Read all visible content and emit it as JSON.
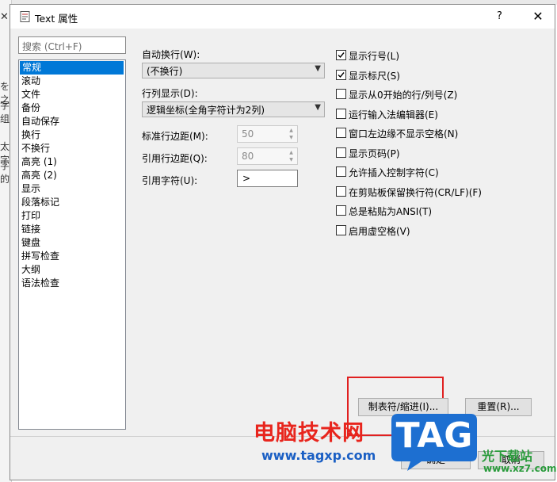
{
  "background": {
    "side_chars": [
      "を之",
      "字组",
      "太字",
      "字的"
    ]
  },
  "dialog": {
    "title": "Text 属性",
    "help": "?",
    "close": "✕"
  },
  "search": {
    "placeholder": "搜索 (Ctrl+F)"
  },
  "categories": [
    "常规",
    "滚动",
    "文件",
    "备份",
    "自动保存",
    "换行",
    "不换行",
    "高亮 (1)",
    "高亮 (2)",
    "显示",
    "段落标记",
    "打印",
    "链接",
    "键盘",
    "拼写检查",
    "大纲",
    "语法检查"
  ],
  "selected_category": "常规",
  "left_panel": {
    "wrap_label": "自动换行(W):",
    "wrap_value": "(不换行)",
    "col_label": "行列显示(D):",
    "col_value": "逻辑坐标(全角字符计为2列)",
    "std_margin_label": "标准行边距(M):",
    "std_margin_value": "50",
    "quote_margin_label": "引用行边距(Q):",
    "quote_margin_value": "80",
    "quote_char_label": "引用字符(U):",
    "quote_char_value": ">"
  },
  "checkboxes": [
    {
      "label": "显示行号(L)",
      "checked": true
    },
    {
      "label": "显示标尺(S)",
      "checked": true
    },
    {
      "label": "显示从0开始的行/列号(Z)",
      "checked": false
    },
    {
      "label": "运行输入法编辑器(E)",
      "checked": false
    },
    {
      "label": "窗口左边缘不显示空格(N)",
      "checked": false
    },
    {
      "label": "显示页码(P)",
      "checked": false
    },
    {
      "label": "允许插入控制字符(C)",
      "checked": false
    },
    {
      "label": "在剪贴板保留换行符(CR/LF)(F)",
      "checked": false
    },
    {
      "label": "总是粘贴为ANSI(T)",
      "checked": false
    },
    {
      "label": "启用虚空格(V)",
      "checked": false
    }
  ],
  "buttons": {
    "tabs": "制表符/缩进(I)...",
    "reset": "重置(R)...",
    "ok": "确定",
    "cancel": "取消"
  },
  "watermark": {
    "brand_cn": "电脑技术网",
    "url": "www.tagxp.com",
    "tag": "TAG",
    "site_cn": "光下载站",
    "site_url": "www.xz7.com"
  },
  "colors": {
    "selection": "#0078d7",
    "highlight_box": "#e02020"
  }
}
